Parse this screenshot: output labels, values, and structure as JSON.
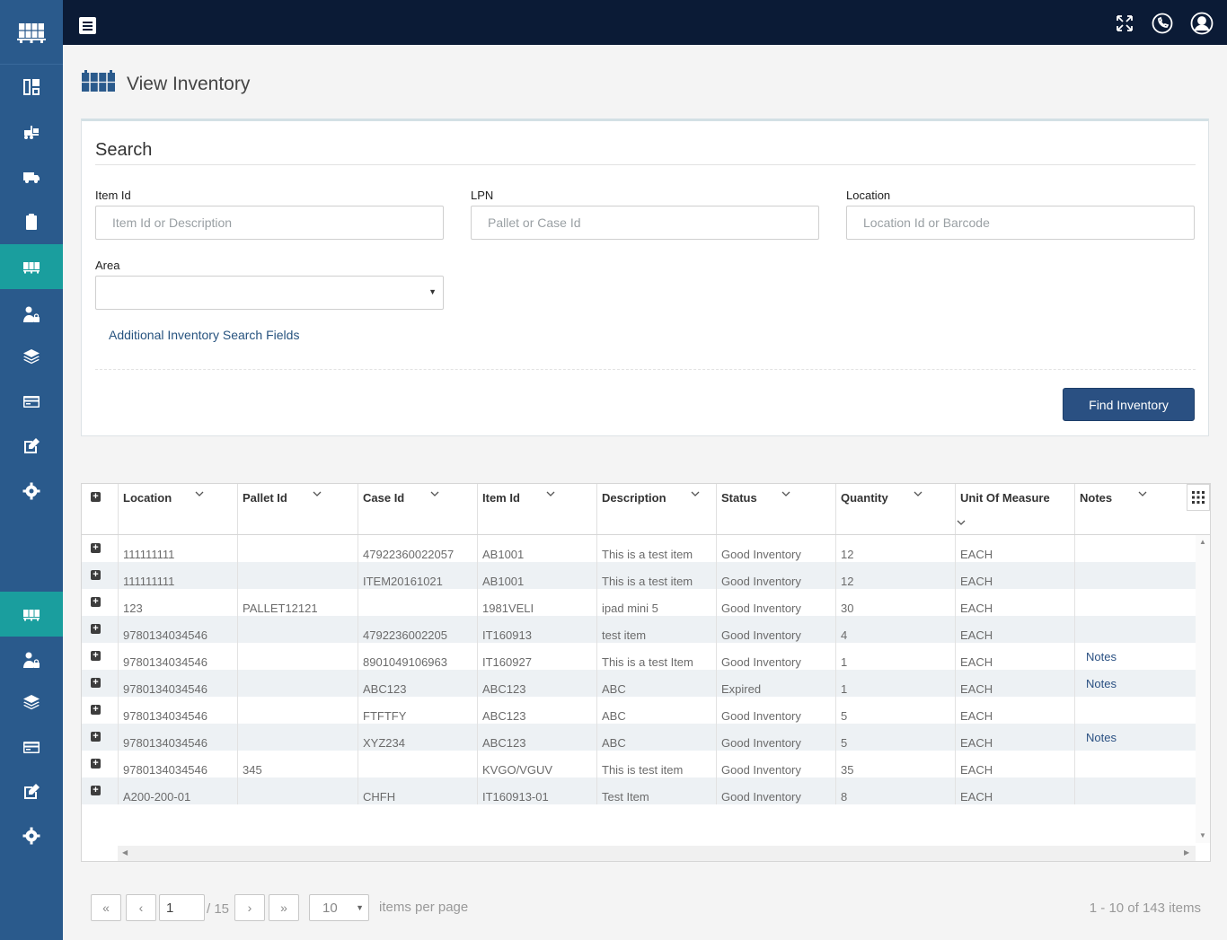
{
  "header": {
    "title": "View Inventory"
  },
  "search": {
    "title": "Search",
    "item_id": {
      "label": "Item Id",
      "placeholder": "Item Id or Description",
      "value": ""
    },
    "lpn": {
      "label": "LPN",
      "placeholder": "Pallet or Case Id",
      "value": ""
    },
    "location": {
      "label": "Location",
      "placeholder": "Location Id or Barcode",
      "value": ""
    },
    "area": {
      "label": "Area",
      "value": ""
    },
    "additional_link": "Additional Inventory Search Fields",
    "find_button": "Find Inventory"
  },
  "grid": {
    "columns": [
      "Location",
      "Pallet Id",
      "Case Id",
      "Item Id",
      "Description",
      "Status",
      "Quantity",
      "Unit Of Measure",
      "Notes"
    ],
    "rows": [
      {
        "location": "111111111",
        "pallet": "",
        "case": "47922360022057",
        "item": "AB1001",
        "description": "This is a test item",
        "status": "Good Inventory",
        "quantity": "12",
        "uom": "EACH",
        "notes": ""
      },
      {
        "location": "111111111",
        "pallet": "",
        "case": "ITEM20161021",
        "item": "AB1001",
        "description": "This is a test item",
        "status": "Good Inventory",
        "quantity": "12",
        "uom": "EACH",
        "notes": ""
      },
      {
        "location": "123",
        "pallet": "PALLET12121",
        "case": "",
        "item": "1981VELI",
        "description": "ipad mini 5",
        "status": "Good Inventory",
        "quantity": "30",
        "uom": "EACH",
        "notes": ""
      },
      {
        "location": "9780134034546",
        "pallet": "",
        "case": "4792236002205",
        "item": "IT160913",
        "description": "test item",
        "status": "Good Inventory",
        "quantity": "4",
        "uom": "EACH",
        "notes": ""
      },
      {
        "location": "9780134034546",
        "pallet": "",
        "case": "8901049106963",
        "item": "IT160927",
        "description": "This is a test Item",
        "status": "Good Inventory",
        "quantity": "1",
        "uom": "EACH",
        "notes": "Notes"
      },
      {
        "location": "9780134034546",
        "pallet": "",
        "case": "ABC123",
        "item": "ABC123",
        "description": "ABC",
        "status": "Expired",
        "quantity": "1",
        "uom": "EACH",
        "notes": "Notes"
      },
      {
        "location": "9780134034546",
        "pallet": "",
        "case": "FTFTFY",
        "item": "ABC123",
        "description": "ABC",
        "status": "Good Inventory",
        "quantity": "5",
        "uom": "EACH",
        "notes": ""
      },
      {
        "location": "9780134034546",
        "pallet": "",
        "case": "XYZ234",
        "item": "ABC123",
        "description": "ABC",
        "status": "Good Inventory",
        "quantity": "5",
        "uom": "EACH",
        "notes": "Notes"
      },
      {
        "location": "9780134034546",
        "pallet": "345",
        "case": "",
        "item": "KVGO/VGUV",
        "description": "This is test item",
        "status": "Good Inventory",
        "quantity": "35",
        "uom": "EACH",
        "notes": ""
      },
      {
        "location": "A200-200-01",
        "pallet": "",
        "case": "CHFH",
        "item": "IT160913-01",
        "description": "Test Item",
        "status": "Good Inventory",
        "quantity": "8",
        "uom": "EACH",
        "notes": ""
      }
    ]
  },
  "pager": {
    "first": "«",
    "prev": "‹",
    "page": "1",
    "total": "/ 15",
    "next": "›",
    "last": "»",
    "page_size": "10",
    "items_per_page": "items per page",
    "info": "1 - 10 of 143 items"
  },
  "icons": {
    "sidebar": [
      "warehouse-logo-icon",
      "dashboard-icon",
      "forklift-icon",
      "truck-icon",
      "clipboard-icon",
      "inventory-icon",
      "user-lock-icon",
      "layers-icon",
      "card-icon",
      "edit-icon",
      "gear-icon",
      "inventory-icon",
      "user-lock-icon",
      "layers-icon",
      "card-icon",
      "edit-icon",
      "gear-icon"
    ],
    "topbar": [
      "menu-icon",
      "fullscreen-icon",
      "phone-icon",
      "user-icon"
    ]
  },
  "colors": {
    "sidebar": "#2a5a8c",
    "sidebar_active": "#1a9e9e",
    "topbar": "#0b1b36",
    "primary_button": "#2a5082",
    "link": "#27537f"
  }
}
